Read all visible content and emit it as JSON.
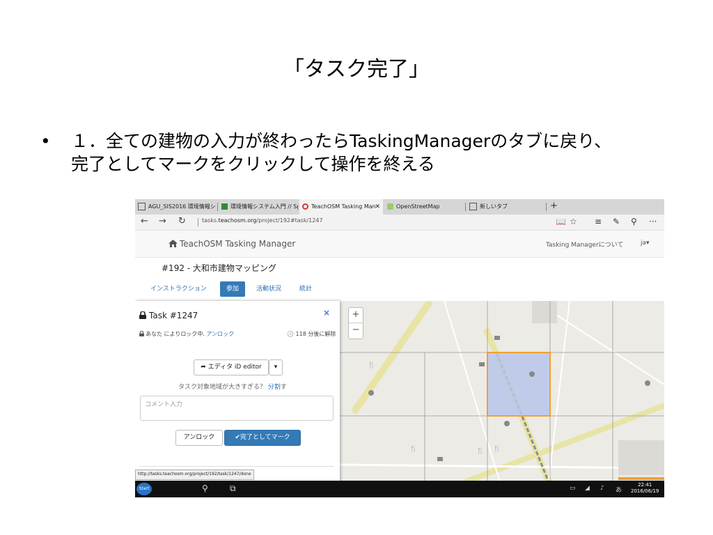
{
  "slide": {
    "title": "「タスク完了」",
    "bullet_symbol": "•",
    "bullet_line1": "１．全ての建物の入力が終わったらTaskingManagerのタブに戻り、",
    "bullet_line2": "完了としてマークをクリックして操作を終える"
  },
  "browser": {
    "tabs": [
      {
        "label": "AGU_SIS2016 環境情報システム"
      },
      {
        "label": "環境情報システム入門 // Spe"
      },
      {
        "label": "TeachOSM Tasking Man",
        "close": "✕"
      },
      {
        "label": "OpenStreetMap"
      },
      {
        "label": "新しいタブ"
      }
    ],
    "new_tab": "+",
    "back": "←",
    "forward": "→",
    "refresh": "↻",
    "url_prefix": "tasks.",
    "url_domain": "teachosm.org",
    "url_path": "/project/192#task/1247",
    "tool_icons": [
      "📖",
      "☆",
      "≡",
      "✎",
      "⚲",
      "···"
    ]
  },
  "tm": {
    "brand": "TeachOSM Tasking Manager",
    "about": "Tasking Managerについて",
    "lang": "ja▾",
    "project_title": "#192 - 大和市建物マッピング",
    "tabs": [
      "インストラクション",
      "参加",
      "活動状況",
      "統計"
    ],
    "task": {
      "title": "Task #1247",
      "close": "×",
      "lock_text": "あなた によりロック中.",
      "unlock_link": "アンロック",
      "time": "118 分後に解除",
      "editor_button": "エディタ iD editor",
      "dropdown": "▾",
      "hint": "タスク対象地域が大きすぎる？",
      "split_link": "分割",
      "hint_end": "す",
      "comment_placeholder": "コメント入力",
      "unlock_button": "アンロック",
      "done_button": "✔完了としてマーク"
    },
    "map": {
      "zoom_in": "+",
      "zoom_out": "−"
    }
  },
  "status_url": "http://tasks.teachosm.org/project/192/task/1247/done",
  "taskbar": {
    "start": "Start",
    "time": "22:41",
    "date": "2016/06/19"
  },
  "colors": {
    "accent": "#337ab7",
    "selected_task_fill": "#b9c6ea",
    "selected_task_border": "#f0a030"
  }
}
